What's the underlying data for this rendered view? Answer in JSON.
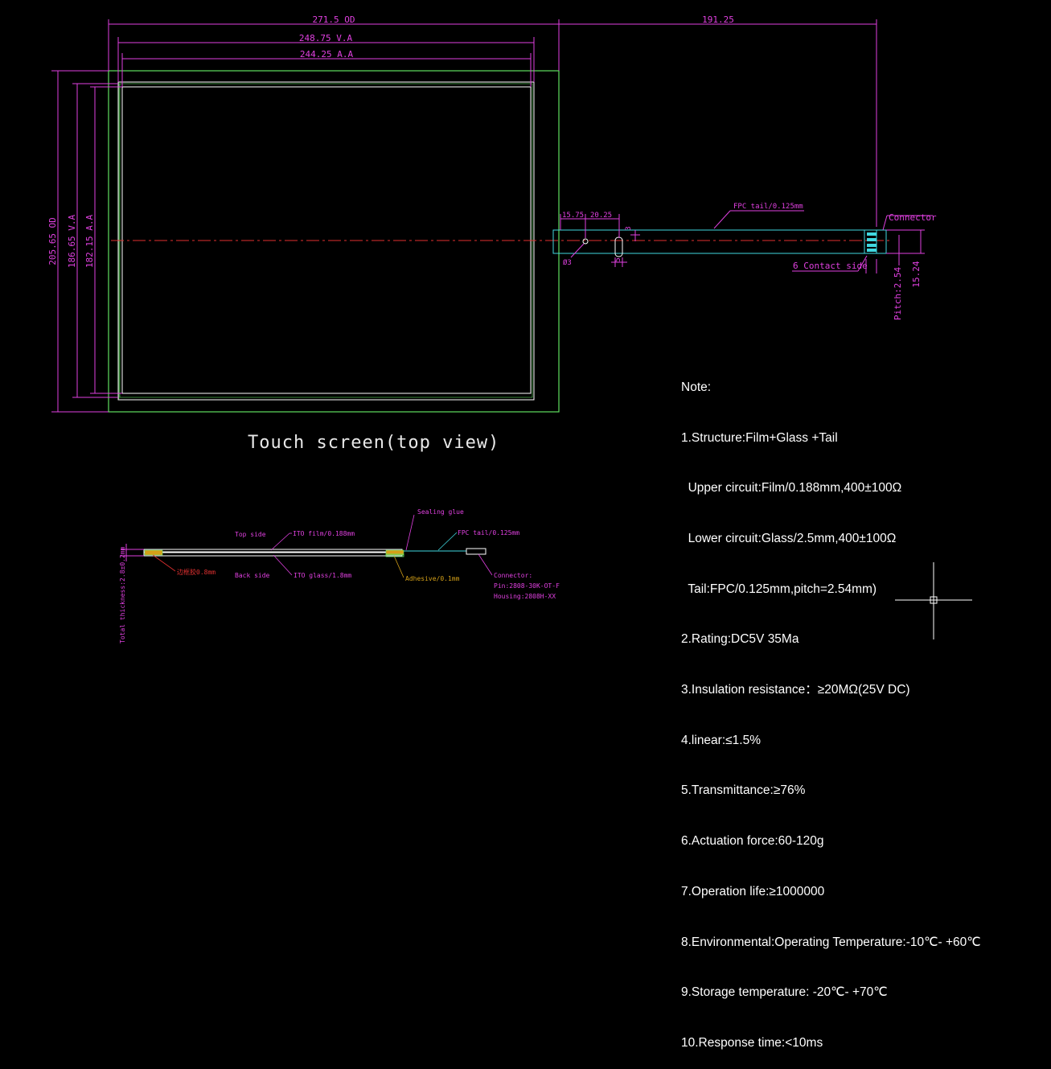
{
  "dimensions": {
    "width_od": "271.5 OD",
    "width_va": "248.75 V.A",
    "width_aa": "244.25 A.A",
    "tail_length": "191.25",
    "height_od": "205.65 OD",
    "height_va": "186.65 V.A",
    "height_aa": "182.15 A.A",
    "tail_offset_1": "15.75",
    "tail_offset_2": "20.25",
    "dim_3": "3",
    "dim_5": "5",
    "hole": "Ø3",
    "fpc_label": "FPC tail/0.125mm",
    "connector_label": "Connector",
    "contact_side": "6 Contact side",
    "pitch": "Pitch:2.54",
    "connector_width": "15.24"
  },
  "view_title": "Touch screen(top view)",
  "section": {
    "top_side": "Top side",
    "back_side": "Back side",
    "ito_film": "ITO film/0.188mm",
    "ito_glass": "ITO glass/1.8mm",
    "sealing_glue": "Sealing glue",
    "fpc_tail": "FPC tail/0.125mm",
    "adhesive": "Adhesive/0.1mm",
    "red_label": "边框胶0.8mm",
    "connector_1": "Connector:",
    "connector_2": "Pin:2808-30K-OT-F",
    "connector_3": "Housing:2808H-XX",
    "total_thickness": "Total thickness:2.8±0.2mm"
  },
  "notes": [
    "Note:",
    "1.Structure:Film+Glass +Tail",
    "  Upper circuit:Film/0.188mm,400±100Ω",
    "  Lower circuit:Glass/2.5mm,400±100Ω",
    "  Tail:FPC/0.125mm,pitch=2.54mm)",
    "2.Rating:DC5V 35Ma",
    "3.Insulation resistance：≥20MΩ(25V DC)",
    "4.linear:≤1.5%",
    "5.Transmittance:≥76%",
    "6.Actuation force:60-120g",
    "7.Operation life:≥1000000",
    "8.Environmental:Operating Temperature:-10℃- +60℃",
    "9.Storage temperature: -20℃- +70℃",
    "10.Response time:<10ms"
  ],
  "colors": {
    "background": "#000000",
    "dimension": "#e040e0",
    "outline": "#5fe05f",
    "tail": "#40d8e0",
    "centerline": "#e03030",
    "text": "#ffffff"
  }
}
